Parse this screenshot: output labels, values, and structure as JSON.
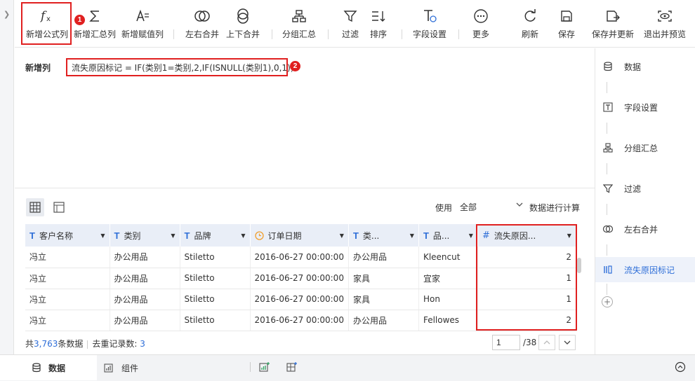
{
  "toolbar": {
    "items": [
      {
        "label": "新增公式列",
        "icon": "fx-icon"
      },
      {
        "label": "新增汇总列",
        "icon": "sigma-icon"
      },
      {
        "label": "新增赋值列",
        "icon": "assign-icon"
      },
      {
        "label": "左右合并",
        "icon": "merge-lr-icon"
      },
      {
        "label": "上下合并",
        "icon": "merge-ud-icon"
      },
      {
        "label": "分组汇总",
        "icon": "group-icon"
      },
      {
        "label": "过滤",
        "icon": "filter-icon"
      },
      {
        "label": "排序",
        "icon": "sort-icon"
      },
      {
        "label": "字段设置",
        "icon": "field-settings-icon"
      },
      {
        "label": "更多",
        "icon": "more-icon"
      },
      {
        "label": "刷新",
        "icon": "refresh-icon"
      },
      {
        "label": "保存",
        "icon": "save-icon"
      },
      {
        "label": "保存并更新",
        "icon": "save-update-icon"
      },
      {
        "label": "退出并预览",
        "icon": "exit-preview-icon"
      }
    ]
  },
  "annotations": {
    "badge1": "1",
    "badge2": "2",
    "color": "#e02020"
  },
  "formula": {
    "title": "新增列",
    "expression": "流失原因标记 = IF(类别1=类别,2,IF(ISNULL(类别1),0,1))"
  },
  "data_view": {
    "use_label": "使用",
    "use_value": "全部",
    "use_tail": "数据进行计算",
    "columns": [
      {
        "label": "客户名称",
        "type": "text"
      },
      {
        "label": "类别",
        "type": "text"
      },
      {
        "label": "品牌",
        "type": "text"
      },
      {
        "label": "订单日期",
        "type": "date"
      },
      {
        "label": "类...",
        "type": "text"
      },
      {
        "label": "品...",
        "type": "text"
      },
      {
        "label": "流失原因...",
        "type": "number"
      }
    ],
    "rows": [
      [
        "冯立",
        "办公用品",
        "Stiletto",
        "2016-06-27 00:00:00",
        "办公用品",
        "Kleencut",
        "2"
      ],
      [
        "冯立",
        "办公用品",
        "Stiletto",
        "2016-06-27 00:00:00",
        "家具",
        "宜家",
        "1"
      ],
      [
        "冯立",
        "办公用品",
        "Stiletto",
        "2016-06-27 00:00:00",
        "家具",
        "Hon",
        "1"
      ],
      [
        "冯立",
        "办公用品",
        "Stiletto",
        "2016-06-27 00:00:00",
        "办公用品",
        "Fellowes",
        "2"
      ]
    ],
    "stats": {
      "prefix": "共",
      "count": "3,763",
      "suffix": "条数据",
      "dedup_label": "去重记录数:",
      "dedup_value": "3"
    },
    "pager": {
      "current": "1",
      "total": "/38"
    }
  },
  "right_panel": {
    "items": [
      {
        "label": "数据",
        "icon": "database-icon"
      },
      {
        "label": "字段设置",
        "icon": "field-settings-icon"
      },
      {
        "label": "分组汇总",
        "icon": "group-icon"
      },
      {
        "label": "过滤",
        "icon": "filter-icon"
      },
      {
        "label": "左右合并",
        "icon": "merge-lr-icon"
      },
      {
        "label": "流失原因标记",
        "icon": "formula-column-icon"
      }
    ],
    "accent": "#2f6fd8"
  },
  "bottom_tabs": {
    "data": "数据",
    "components": "组件"
  }
}
